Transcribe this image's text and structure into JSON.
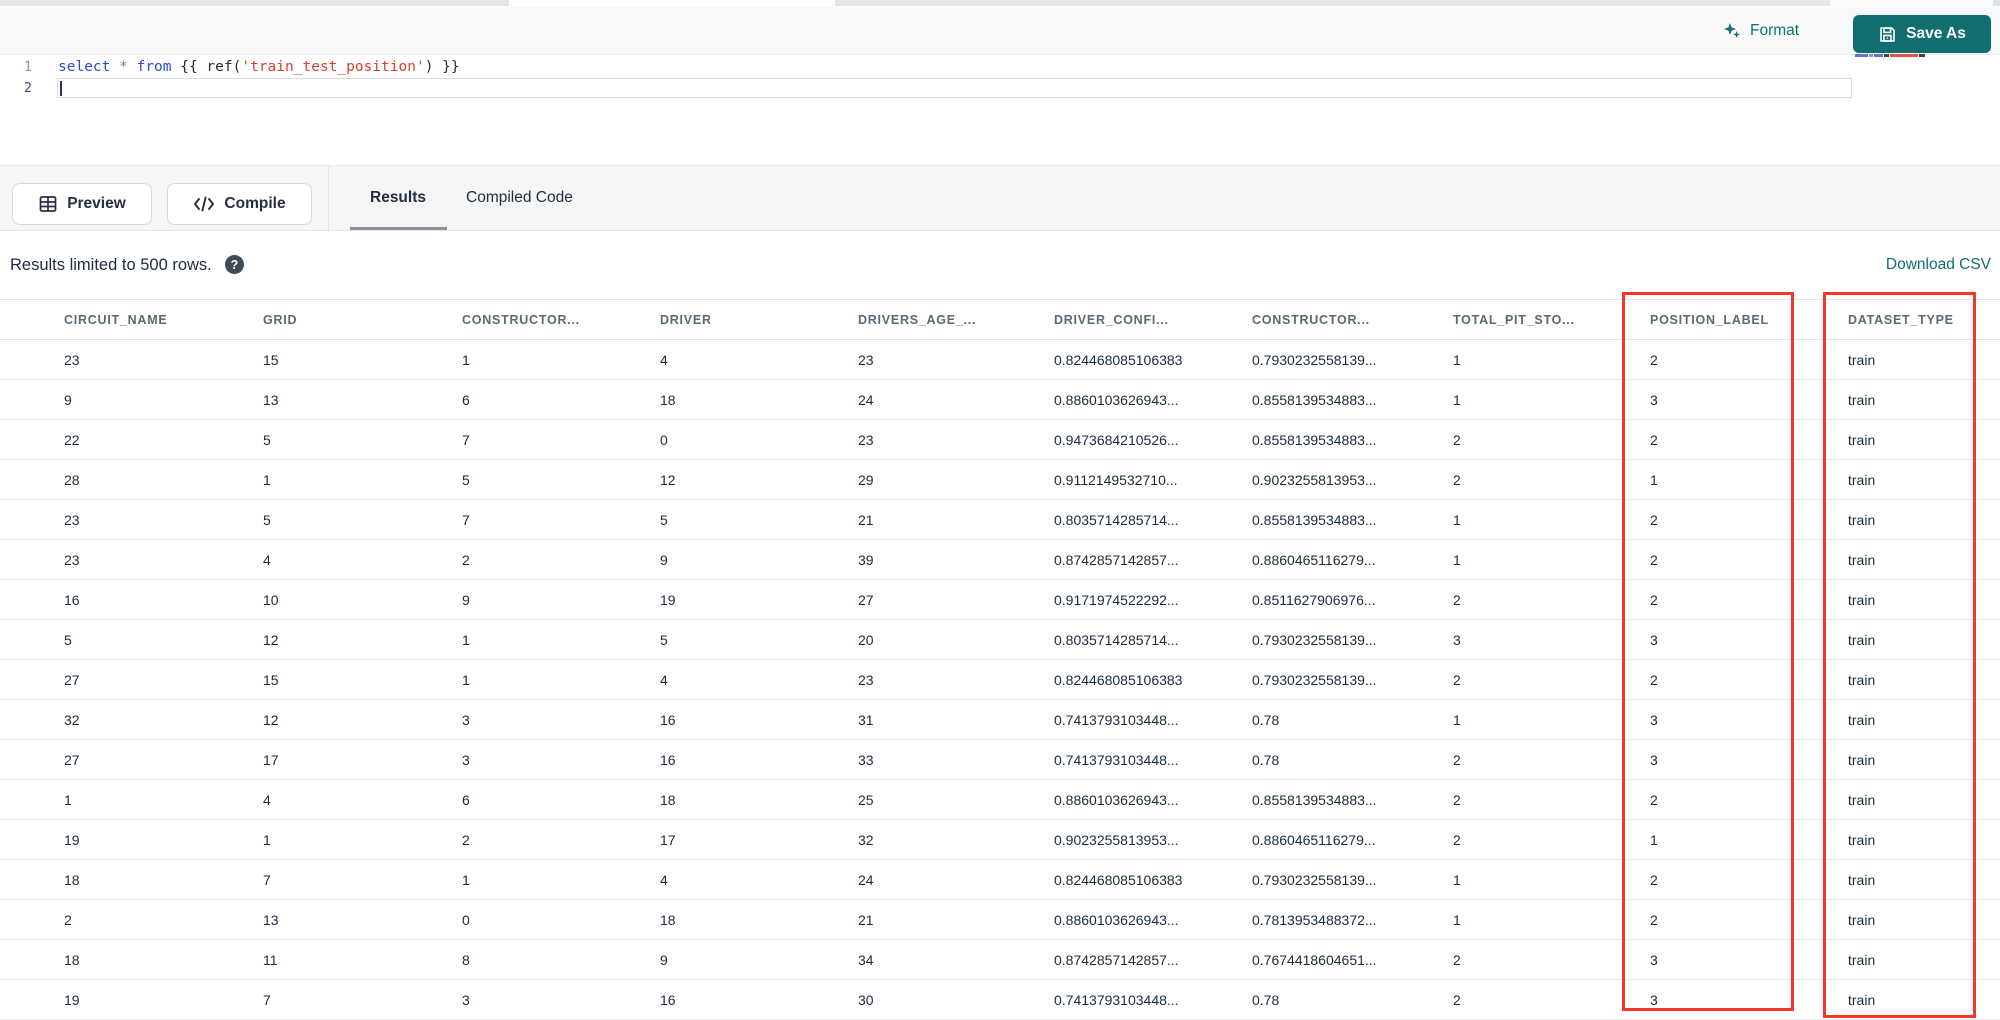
{
  "toolbar": {
    "format_label": "Format",
    "save_as_label": "Save As"
  },
  "editor": {
    "lines": [
      {
        "number": "1",
        "active": false,
        "tokens": [
          {
            "text": "select",
            "type": "keyword"
          },
          {
            "text": " ",
            "type": "plain"
          },
          {
            "text": "*",
            "type": "operator"
          },
          {
            "text": " ",
            "type": "plain"
          },
          {
            "text": "from",
            "type": "keyword"
          },
          {
            "text": " {{ ref(",
            "type": "plain"
          },
          {
            "text": "'train_test_position'",
            "type": "string"
          },
          {
            "text": ") }}",
            "type": "plain"
          }
        ]
      },
      {
        "number": "2",
        "active": true,
        "tokens": []
      }
    ]
  },
  "actions": {
    "preview_label": "Preview",
    "compile_label": "Compile"
  },
  "tabs": [
    {
      "label": "Results",
      "active": true
    },
    {
      "label": "Compiled Code",
      "active": false
    }
  ],
  "results": {
    "limit_text": "Results limited to 500 rows.",
    "help_glyph": "?",
    "download_label": "Download CSV"
  },
  "table": {
    "columns": [
      "CIRCUIT_NAME",
      "GRID",
      "CONSTRUCTOR...",
      "DRIVER",
      "DRIVERS_AGE_...",
      "DRIVER_CONFI...",
      "CONSTRUCTOR...",
      "TOTAL_PIT_STO...",
      "POSITION_LABEL",
      "DATASET_TYPE"
    ],
    "highlighted_columns": [
      "POSITION_LABEL",
      "DATASET_TYPE"
    ],
    "rows": [
      [
        "23",
        "15",
        "1",
        "4",
        "23",
        "0.824468085106383",
        "0.7930232558139...",
        "1",
        "2",
        "train"
      ],
      [
        "9",
        "13",
        "6",
        "18",
        "24",
        "0.8860103626943...",
        "0.8558139534883...",
        "1",
        "3",
        "train"
      ],
      [
        "22",
        "5",
        "7",
        "0",
        "23",
        "0.9473684210526...",
        "0.8558139534883...",
        "2",
        "2",
        "train"
      ],
      [
        "28",
        "1",
        "5",
        "12",
        "29",
        "0.9112149532710...",
        "0.9023255813953...",
        "2",
        "1",
        "train"
      ],
      [
        "23",
        "5",
        "7",
        "5",
        "21",
        "0.8035714285714...",
        "0.8558139534883...",
        "1",
        "2",
        "train"
      ],
      [
        "23",
        "4",
        "2",
        "9",
        "39",
        "0.8742857142857...",
        "0.8860465116279...",
        "1",
        "2",
        "train"
      ],
      [
        "16",
        "10",
        "9",
        "19",
        "27",
        "0.9171974522292...",
        "0.8511627906976...",
        "2",
        "2",
        "train"
      ],
      [
        "5",
        "12",
        "1",
        "5",
        "20",
        "0.8035714285714...",
        "0.7930232558139...",
        "3",
        "3",
        "train"
      ],
      [
        "27",
        "15",
        "1",
        "4",
        "23",
        "0.824468085106383",
        "0.7930232558139...",
        "2",
        "2",
        "train"
      ],
      [
        "32",
        "12",
        "3",
        "16",
        "31",
        "0.7413793103448...",
        "0.78",
        "1",
        "3",
        "train"
      ],
      [
        "27",
        "17",
        "3",
        "16",
        "33",
        "0.7413793103448...",
        "0.78",
        "2",
        "3",
        "train"
      ],
      [
        "1",
        "4",
        "6",
        "18",
        "25",
        "0.8860103626943...",
        "0.8558139534883...",
        "2",
        "2",
        "train"
      ],
      [
        "19",
        "1",
        "2",
        "17",
        "32",
        "0.9023255813953...",
        "0.8860465116279...",
        "2",
        "1",
        "train"
      ],
      [
        "18",
        "7",
        "1",
        "4",
        "24",
        "0.824468085106383",
        "0.7930232558139...",
        "1",
        "2",
        "train"
      ],
      [
        "2",
        "13",
        "0",
        "18",
        "21",
        "0.8860103626943...",
        "0.7813953488372...",
        "1",
        "2",
        "train"
      ],
      [
        "18",
        "11",
        "8",
        "9",
        "34",
        "0.8742857142857...",
        "0.7674418604651...",
        "2",
        "3",
        "train"
      ],
      [
        "19",
        "7",
        "3",
        "16",
        "30",
        "0.7413793103448...",
        "0.78",
        "2",
        "3",
        "train"
      ]
    ]
  },
  "colors": {
    "accent_teal": "#11706f",
    "highlight_red": "#f5372a"
  }
}
